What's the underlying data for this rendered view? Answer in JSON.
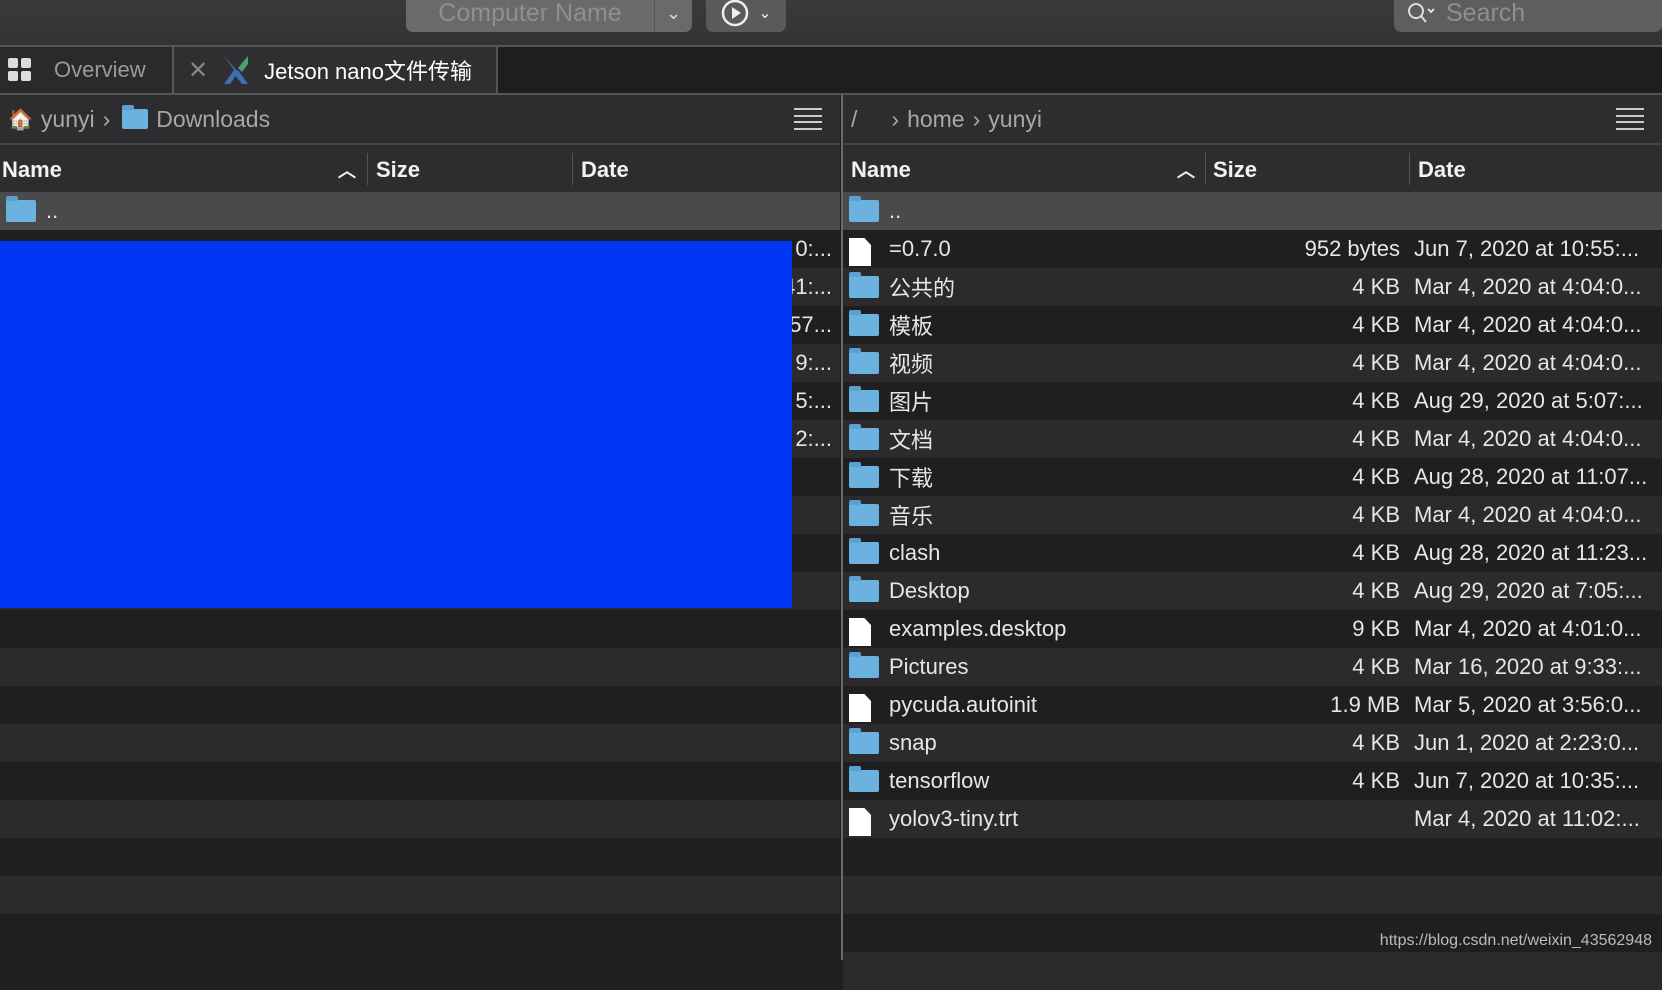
{
  "toolbar": {
    "computer_name_placeholder": "Computer Name",
    "search_placeholder": "Search"
  },
  "tabs": [
    {
      "label": "Overview"
    },
    {
      "label": "Jetson nano文件传输"
    }
  ],
  "left": {
    "path": [
      "yunyi",
      "Downloads"
    ],
    "columns": [
      "Name",
      "Size",
      "Date"
    ],
    "rows": [
      {
        "name": "..",
        "type": "folder"
      }
    ],
    "visible_date_fragments": [
      "0:...",
      "41:...",
      "57...",
      "9:...",
      "5:...",
      "2:..."
    ]
  },
  "right": {
    "path": [
      "/",
      "home",
      "yunyi"
    ],
    "columns": [
      "Name",
      "Size",
      "Date"
    ],
    "rows": [
      {
        "name": "..",
        "type": "folder",
        "size": "",
        "date": ""
      },
      {
        "name": "=0.7.0",
        "type": "file",
        "size": "952 bytes",
        "date": "Jun 7, 2020 at 10:55:..."
      },
      {
        "name": "公共的",
        "type": "folder",
        "size": "4 KB",
        "date": "Mar 4, 2020 at 4:04:0..."
      },
      {
        "name": "模板",
        "type": "folder",
        "size": "4 KB",
        "date": "Mar 4, 2020 at 4:04:0..."
      },
      {
        "name": "视频",
        "type": "folder",
        "size": "4 KB",
        "date": "Mar 4, 2020 at 4:04:0..."
      },
      {
        "name": "图片",
        "type": "folder",
        "size": "4 KB",
        "date": "Aug 29, 2020 at 5:07:..."
      },
      {
        "name": "文档",
        "type": "folder",
        "size": "4 KB",
        "date": "Mar 4, 2020 at 4:04:0..."
      },
      {
        "name": "下载",
        "type": "folder",
        "size": "4 KB",
        "date": "Aug 28, 2020 at 11:07..."
      },
      {
        "name": "音乐",
        "type": "folder",
        "size": "4 KB",
        "date": "Mar 4, 2020 at 4:04:0..."
      },
      {
        "name": "clash",
        "type": "folder",
        "size": "4 KB",
        "date": "Aug 28, 2020 at 11:23..."
      },
      {
        "name": "Desktop",
        "type": "folder",
        "size": "4 KB",
        "date": "Aug 29, 2020 at 7:05:..."
      },
      {
        "name": "examples.desktop",
        "type": "file",
        "size": "9 KB",
        "date": "Mar 4, 2020 at 4:01:0..."
      },
      {
        "name": "Pictures",
        "type": "folder",
        "size": "4 KB",
        "date": "Mar 16, 2020 at 9:33:..."
      },
      {
        "name": "pycuda.autoinit",
        "type": "file",
        "size": "1.9 MB",
        "date": "Mar 5, 2020 at 3:56:0..."
      },
      {
        "name": "snap",
        "type": "folder",
        "size": "4 KB",
        "date": "Jun 1, 2020 at 2:23:0..."
      },
      {
        "name": "tensorflow",
        "type": "folder",
        "size": "4 KB",
        "date": "Jun 7, 2020 at 10:35:..."
      },
      {
        "name": "yolov3-tiny.trt",
        "type": "file",
        "size": "",
        "date": "Mar 4, 2020 at 11:02:..."
      }
    ]
  },
  "watermark": "https://blog.csdn.net/weixin_43562948",
  "colors": {
    "redaction": "#0037f5",
    "folder": "#6cb2e0"
  }
}
